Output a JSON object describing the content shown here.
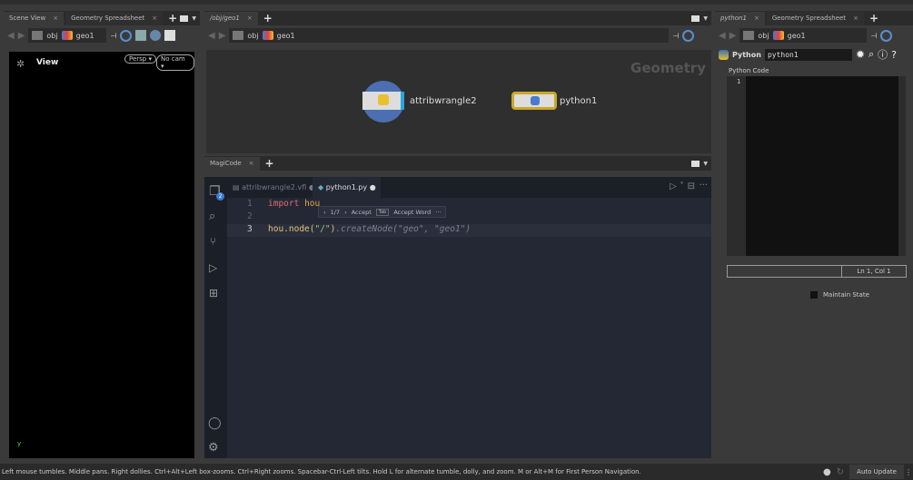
{
  "left": {
    "tabs": [
      {
        "label": "Scene View"
      },
      {
        "label": "Geometry Spreadsheet"
      }
    ],
    "path": {
      "obj": "obj",
      "geo": "geo1"
    },
    "view_label": "View",
    "persp": "Persp",
    "cam": "No cam",
    "axis": "y"
  },
  "middle": {
    "tabs": [
      {
        "label": "/obj/geo1"
      }
    ],
    "path": {
      "obj": "obj",
      "geo": "geo1"
    },
    "network_label": "Geometry",
    "nodes": [
      {
        "name": "attribwrangle2"
      },
      {
        "name": "python1"
      }
    ]
  },
  "editor": {
    "panel_tab": "MagiCode",
    "file_tabs": [
      {
        "label": "attribwrangle2.vfl"
      },
      {
        "label": "python1.py"
      }
    ],
    "badge": "2",
    "lines": [
      {
        "num": "1"
      },
      {
        "num": "2"
      },
      {
        "num": "3"
      }
    ],
    "line1_kw": "import",
    "line1_mod": "hou",
    "line3_a": "hou.node(",
    "line3_b": "\"/\"",
    "line3_c": ")",
    "line3_ghost": ".createNode(\"geo\", \"geo1\")",
    "suggest": {
      "count": "1/7",
      "accept": "Accept",
      "key": "Tab",
      "accept_word": "Accept Word",
      "more": "···"
    }
  },
  "right": {
    "tabs": [
      {
        "label": "python1"
      },
      {
        "label": "Geometry Spreadsheet"
      }
    ],
    "path": {
      "obj": "obj",
      "geo": "geo1"
    },
    "node_type": "Python",
    "node_name": "python1",
    "code_label": "Python Code",
    "code_line": "1",
    "cursor_pos": "Ln 1, Col 1",
    "maintain_state": "Maintain State"
  },
  "status": {
    "message": "Left mouse tumbles. Middle pans. Right dollies. Ctrl+Alt+Left box-zooms. Ctrl+Right zooms. Spacebar-Ctrl-Left tilts. Hold L for alternate tumble, dolly, and zoom. M or Alt+M for First Person Navigation.",
    "auto_update": "Auto Update"
  }
}
